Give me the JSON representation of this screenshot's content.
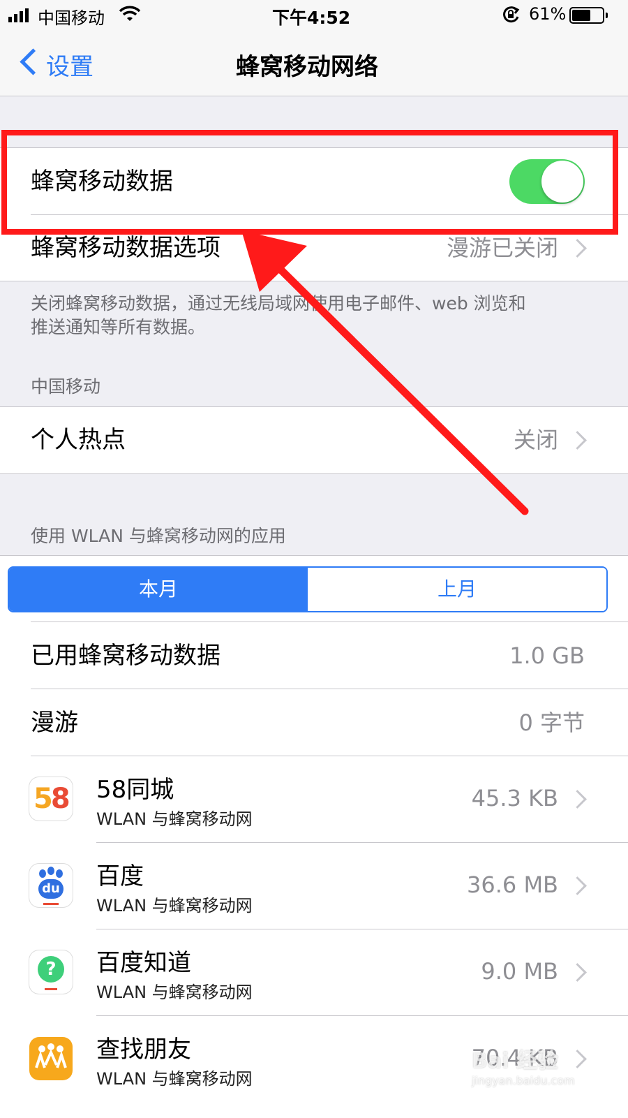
{
  "status_bar": {
    "carrier": "中国移动",
    "time": "下午4:52",
    "battery": "61%"
  },
  "nav": {
    "back_label": "设置",
    "title": "蜂窝移动网络"
  },
  "cellular_data": {
    "label": "蜂窝移动数据",
    "enabled": true
  },
  "cellular_options": {
    "label": "蜂窝移动数据选项",
    "value": "漫游已关闭"
  },
  "footer_note": {
    "line1": "关闭蜂窝移动数据，通过无线局域网使用电子邮件、web 浏览和",
    "line2": "推送通知等所有数据。"
  },
  "carrier_section": {
    "header": "中国移动"
  },
  "hotspot": {
    "label": "个人热点",
    "value": "关闭"
  },
  "apps_section": {
    "header": "使用 WLAN 与蜂窝移动网的应用"
  },
  "segmented": {
    "current": "本月",
    "last": "上月",
    "selected": "本月"
  },
  "usage": {
    "used_label": "已用蜂窝移动数据",
    "used_value": "1.0 GB",
    "roaming_label": "漫游",
    "roaming_value": "0 字节"
  },
  "apps": [
    {
      "name": "58同城",
      "sub": "WLAN 与蜂窝移动网",
      "value": "45.3 KB",
      "icon": "58-icon"
    },
    {
      "name": "百度",
      "sub": "WLAN 与蜂窝移动网",
      "value": "36.6 MB",
      "icon": "baidu-paw-icon"
    },
    {
      "name": "百度知道",
      "sub": "WLAN 与蜂窝移动网",
      "value": "9.0 MB",
      "icon": "baidu-zhidao-icon"
    },
    {
      "name": "查找朋友",
      "sub": "WLAN 与蜂窝移动网",
      "value": "70.4 KB",
      "icon": "find-friends-icon"
    }
  ],
  "icon_glyphs": {
    "baidu": "du",
    "zhidao": "?"
  },
  "watermark": {
    "line1": "Bai 经验",
    "line2": "jingyan.baidu.com"
  },
  "colors": {
    "accent": "#2f7cf6",
    "switch_on": "#4cd964",
    "annotation": "#ff1a1a"
  }
}
